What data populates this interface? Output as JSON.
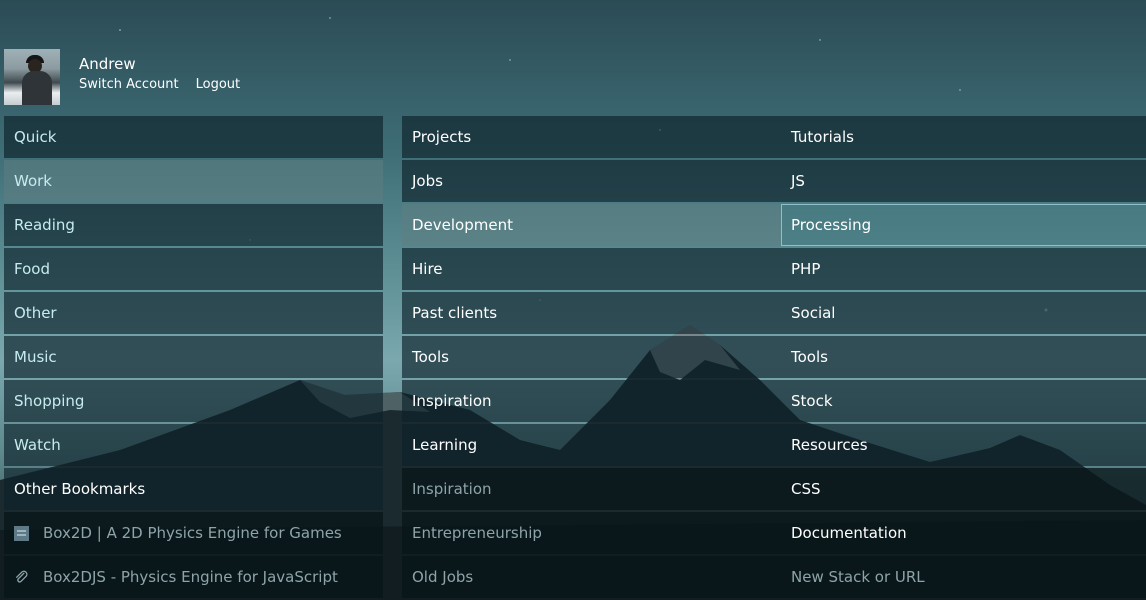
{
  "user": {
    "name": "Andrew",
    "switch_account": "Switch Account",
    "logout": "Logout"
  },
  "columns": {
    "left": {
      "items": [
        "Quick",
        "Work",
        "Reading",
        "Food",
        "Other",
        "Music",
        "Shopping",
        "Watch",
        "Other Bookmarks"
      ],
      "bookmarks": [
        {
          "label": "Box2D | A 2D Physics Engine for Games",
          "icon": "document-icon"
        },
        {
          "label": "Box2DJS - Physics Engine for JavaScript",
          "icon": "paperclip-icon"
        }
      ]
    },
    "middle": {
      "items": [
        "Projects",
        "Jobs",
        "Development",
        "Hire",
        "Past clients",
        "Tools",
        "Inspiration",
        "Learning",
        "Inspiration",
        "Entrepreneurship",
        "Old Jobs"
      ]
    },
    "right": {
      "items": [
        "Tutorials",
        "JS",
        "Processing",
        "PHP",
        "Social",
        "Tools",
        "Stock",
        "Resources",
        "CSS",
        "Documentation"
      ],
      "new_stack_placeholder": "New Stack or URL"
    }
  },
  "colors": {
    "tile_bg": "#0e222a",
    "accent_text": "#c6ecef",
    "muted_text": "#8ea4a8",
    "selected_border": "#96c8d2"
  }
}
